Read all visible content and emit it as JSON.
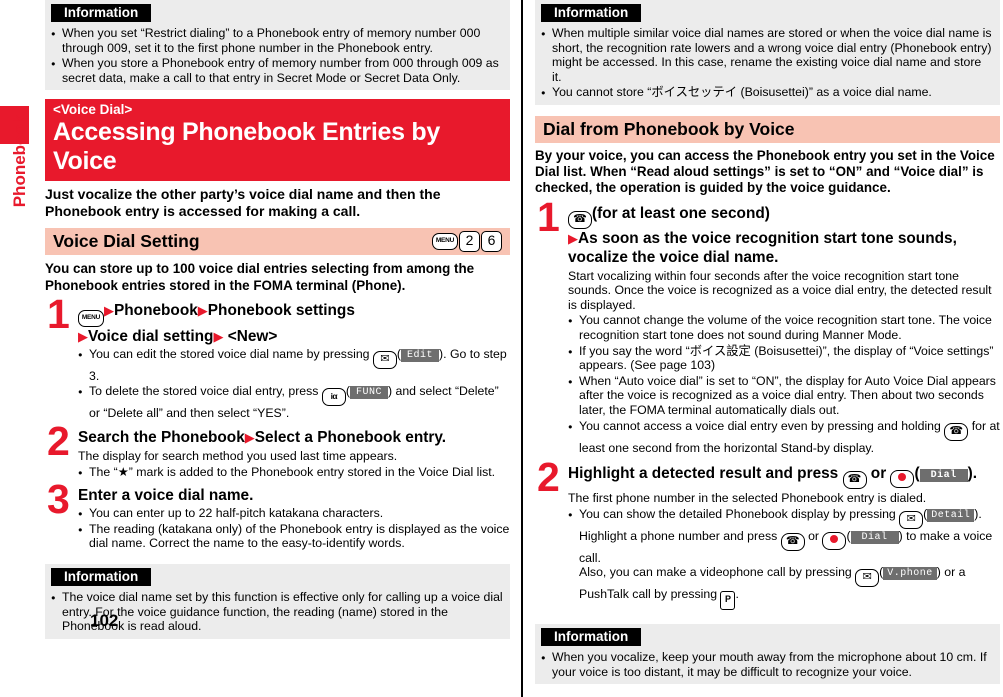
{
  "page": {
    "number": "102",
    "side_tab_label": "Phonebook",
    "accent_red": "#e8192c",
    "accent_pink": "#f8c3b3",
    "info_bg": "#ececec"
  },
  "left": {
    "info_top": {
      "heading": "Information",
      "bullets": [
        "When you set “Restrict dialing” to a Phonebook entry of memory number 000 through 009, set it to the first phone number in the Phonebook entry.",
        "When you store a Phonebook entry of memory number from 000 through 009 as secret data, make a call to that entry in Secret Mode or Secret Data Only."
      ]
    },
    "title_band": {
      "kicker": "<Voice Dial>",
      "title": "Accessing Phonebook Entries by Voice"
    },
    "lead": "Just vocalize the other party’s voice dial name and then the Phonebook entry is accessed for making a call.",
    "section": {
      "heading": "Voice Dial Setting",
      "keys": [
        "MENU",
        "2",
        "6"
      ]
    },
    "intro": "You can store up to 100 voice dial entries selecting from among the Phonebook entries stored in the FOMA terminal (Phone).",
    "steps": [
      {
        "num": "1",
        "title_part1": "Phonebook",
        "title_part2": "Phonebook settings",
        "title_part3": "Voice dial setting",
        "title_part4": "<New>",
        "key": "MENU",
        "bullets": [
          {
            "pre": "You can edit the stored voice dial name by pressing ",
            "key": "mail-key",
            "softkey": "Edit",
            "post": "). Go to step 3."
          },
          {
            "pre": "To delete the stored voice dial entry, press ",
            "key": "imode-key",
            "softkey": "FUNC",
            "post": ") and select “Delete” or “Delete all” and then select “YES”."
          }
        ]
      },
      {
        "num": "2",
        "title_part1": "Search the Phonebook",
        "title_part2": "Select a Phonebook entry.",
        "sub": "The display for search method you used last time appears.",
        "bullets": [
          "The “★” mark is added to the Phonebook entry stored in the Voice Dial list."
        ]
      },
      {
        "num": "3",
        "title_part1": "Enter a voice dial name.",
        "bullets": [
          "You can enter up to 22 half-pitch katakana characters.",
          "The reading (katakana only) of the Phonebook entry is displayed as the voice dial name. Correct the name to the easy-to-identify words."
        ]
      }
    ],
    "info_bottom": {
      "heading": "Information",
      "bullets": [
        "The voice dial name set by this function is effective only for calling up a voice dial entry. For the voice guidance function, the reading (name) stored in the Phonebook is read aloud."
      ]
    }
  },
  "right": {
    "info_top": {
      "heading": "Information",
      "bullets": [
        "When multiple similar voice dial names are stored or when the voice dial name is short, the recognition rate lowers and a wrong voice dial entry (Phonebook entry) might be accessed. In this case, rename the existing voice dial name and store it.",
        "You cannot store “ボイスセッテイ (Boisusettei)” as a voice dial name."
      ]
    },
    "section": {
      "heading": "Dial from Phonebook by Voice"
    },
    "lead": "By your voice, you can access the Phonebook entry you set in the Voice Dial list. When “Read aloud settings” is set to “ON” and “Voice dial” is checked, the operation is guided by the voice guidance.",
    "steps": [
      {
        "num": "1",
        "title_part1": "(for at least one second)",
        "title_part2": "As soon as the voice recognition start tone sounds, vocalize the voice dial name.",
        "sub": "Start vocalizing within four seconds after the voice recognition start tone sounds. Once the voice is recognized as a voice dial entry, the detected result is displayed.",
        "bullets": [
          "You cannot change the volume of the voice recognition start tone. The voice recognition start tone does not sound during Manner Mode.",
          "If you say the word “ボイス設定 (Boisusettei)”, the display of “Voice settings” appears. (See page 103)",
          "When “Auto voice dial” is set to “ON”, the display for Auto Voice Dial appears after the voice is recognized as a voice dial entry. Then about two seconds later, the FOMA terminal automatically dials out.",
          "You cannot access a voice dial entry even by pressing and holding ||CALL|| for at least one second from the horizontal Stand-by display."
        ]
      },
      {
        "num": "2",
        "title_pre": "Highlight a detected result and press ",
        "title_or": " or ",
        "softkey": "Dial",
        "title_post": ").",
        "sub": "The first phone number in the selected Phonebook entry is dialed.",
        "bullet_detail": {
          "l1_pre": "You can show the detailed Phonebook display by pressing ",
          "l1_softkey": "Detail",
          "l1_post": ").",
          "l2_pre": "Highlight a phone number and press ",
          "l2_or": " or ",
          "l2_softkey": "Dial",
          "l2_post": ") to make a voice call.",
          "l3_pre": "Also, you can make a videophone call by pressing ",
          "l3_softkey": "V.phone",
          "l3_post": ") or a PushTalk call by pressing ",
          "l3_end": "."
        }
      }
    ],
    "info_bottom": {
      "heading": "Information",
      "bullets": [
        "When you vocalize, keep your mouth away from the microphone about 10 cm. If your voice is too distant, it may be difficult to recognize your voice."
      ]
    }
  }
}
